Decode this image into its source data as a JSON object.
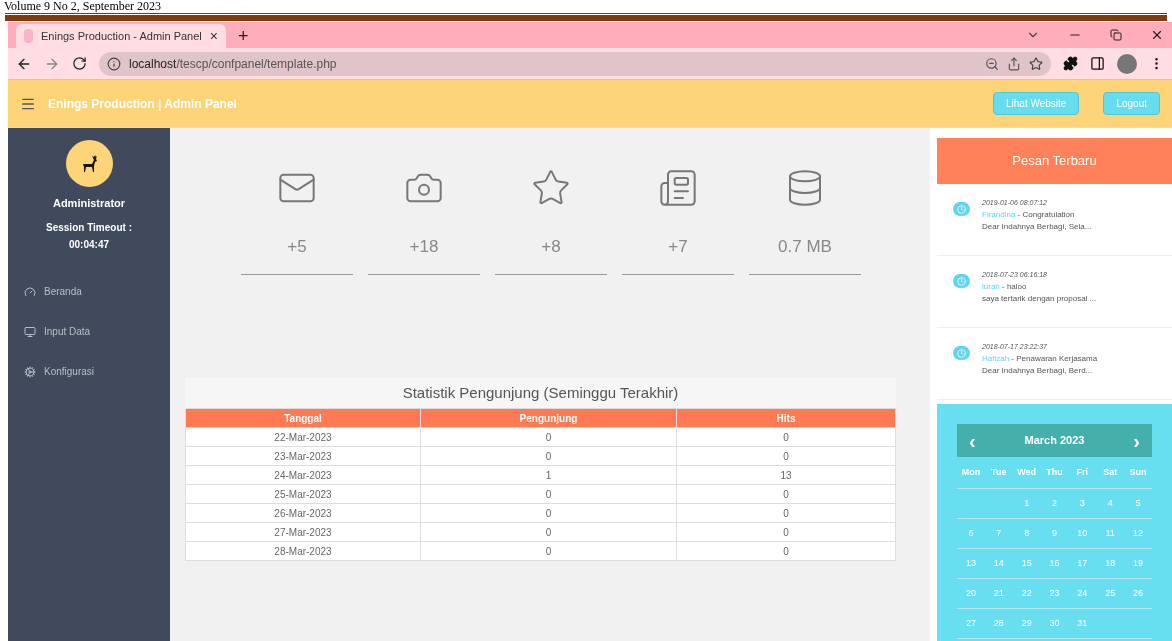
{
  "document_header": "Volume 9 No 2, September 2023",
  "browser": {
    "tab_title": "Enings Production - Admin Panel",
    "tab_close": "×",
    "new_tab": "+",
    "url_host": "localhost",
    "url_path": "/tescp/confpanel/template.php"
  },
  "topbar": {
    "title": "Enings Production | Admin Panel",
    "buttons": [
      "Lihat Website",
      "Logout"
    ]
  },
  "sidebar": {
    "user": "Administrator",
    "session_label": "Session Timeout :",
    "session_time": "00:04:47",
    "items": [
      {
        "kind": "dashboard",
        "label": "Beranda"
      },
      {
        "kind": "monitor",
        "label": "Input Data"
      },
      {
        "kind": "cogs",
        "label": "Konfigurasi"
      }
    ]
  },
  "stats": [
    {
      "kind": "mail",
      "value": "+5"
    },
    {
      "kind": "camera",
      "value": "+18"
    },
    {
      "kind": "star",
      "value": "+8"
    },
    {
      "kind": "news",
      "value": "+7"
    },
    {
      "kind": "database",
      "value": "0.7 MB"
    }
  ],
  "table": {
    "title": "Statistik Pengunjung (Seminggu Terakhir)",
    "columns": [
      "Tanggal",
      "Pengunjung",
      "Hits"
    ],
    "rows": [
      [
        "22-Mar-2023",
        "0",
        "0"
      ],
      [
        "23-Mar-2023",
        "0",
        "0"
      ],
      [
        "24-Mar-2023",
        "1",
        "13"
      ],
      [
        "25-Mar-2023",
        "0",
        "0"
      ],
      [
        "26-Mar-2023",
        "0",
        "0"
      ],
      [
        "27-Mar-2023",
        "0",
        "0"
      ],
      [
        "28-Mar-2023",
        "0",
        "0"
      ]
    ]
  },
  "messages": {
    "title": "Pesan Terbaru",
    "items": [
      {
        "time": "2019-01-06 08:07:12",
        "sender": "Firandina",
        "subject": " - Congratulation",
        "preview": "Dear Indahnya Berbagi, Sela..."
      },
      {
        "time": "2018-07-23 06:16:18",
        "sender": "lurah",
        "subject": " - haloo",
        "preview": "saya tertarik dengan proposal ..."
      },
      {
        "time": "2018-07-17 23:22:37",
        "sender": "Hafizah",
        "subject": " - Penawaran Kerjasama",
        "preview": "Dear Indahnya Berbagi, Berd..."
      }
    ]
  },
  "calendar": {
    "prev": "‹",
    "month": "March 2023",
    "next": "›",
    "weekdays": [
      "Mon",
      "Tue",
      "Wed",
      "Thu",
      "Fri",
      "Sat",
      "Sun"
    ],
    "weeks": [
      {
        "kind": "leading",
        "days": [
          "1",
          "2",
          "3",
          "4",
          "5"
        ]
      },
      {
        "kind": "full",
        "days": [
          "6",
          "7",
          "8",
          "9",
          "10",
          "11",
          "12"
        ]
      },
      {
        "kind": "full",
        "days": [
          "13",
          "14",
          "15",
          "16",
          "17",
          "18",
          "19"
        ]
      },
      {
        "kind": "full",
        "days": [
          "20",
          "21",
          "22",
          "23",
          "24",
          "25",
          "26"
        ]
      },
      {
        "kind": "trailing",
        "days": [
          "27",
          "28",
          "29",
          "30",
          "31"
        ]
      }
    ]
  }
}
